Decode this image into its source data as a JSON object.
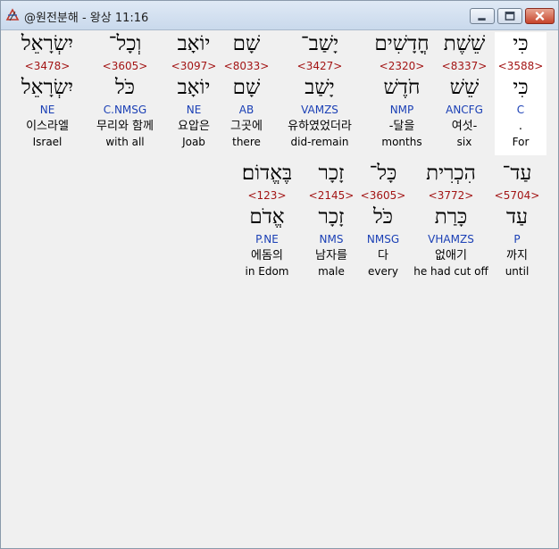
{
  "window": {
    "title": "@원전분해 - 왕상 11:16"
  },
  "lines": [
    {
      "words": [
        {
          "surface": "כִּי",
          "strong": "<3588>",
          "lemma": "כִּי",
          "morph": "C",
          "korean": ".",
          "english": "For",
          "center": 581
        },
        {
          "surface": "שֵׁשֶׁת",
          "strong": "<8337>",
          "lemma": "שֵׁשׁ",
          "morph": "ANCFG",
          "korean": "여섯-",
          "english": "six",
          "center": 518
        },
        {
          "surface": "חֳדָשִׁים",
          "strong": "<2320>",
          "lemma": "חֹדֶשׁ",
          "morph": "NMP",
          "korean": "-달을",
          "english": "months",
          "center": 448
        },
        {
          "surface": "יָשַׁב־",
          "strong": "<3427>",
          "lemma": "יָשַׁב",
          "morph": "VAMZS",
          "korean": "유하였었더라",
          "english": "did-remain",
          "center": 356
        },
        {
          "surface": "שָׁם",
          "strong": "<8033>",
          "lemma": "שָׁם",
          "morph": "AB",
          "korean": "그곳에",
          "english": "there",
          "center": 274
        },
        {
          "surface": "יוֹאָב",
          "strong": "<3097>",
          "lemma": "יוֹאָב",
          "morph": "NE",
          "korean": "요압은",
          "english": "Joab",
          "center": 215
        },
        {
          "surface": "וְכָל־",
          "strong": "<3605>",
          "lemma": "כֹּל",
          "morph": "C.NMSG",
          "korean": "무리와 함께",
          "english": "with all",
          "center": 138
        },
        {
          "surface": "יִשְׂרָאֵל",
          "strong": "<3478>",
          "lemma": "יִשְׂרָאֵל",
          "morph": "NE",
          "korean": "이스라엘",
          "english": "Israel",
          "center": 51
        }
      ]
    },
    {
      "words": [
        {
          "surface": "עַד־",
          "strong": "<5704>",
          "lemma": "עַד",
          "morph": "P",
          "korean": "까지",
          "english": "until",
          "center": 577
        },
        {
          "surface": "הִכְרִית",
          "strong": "<3772>",
          "lemma": "כָּרַת",
          "morph": "VHAMZS",
          "korean": "없애기",
          "english": "he had cut off",
          "center": 503
        },
        {
          "surface": "כָּל־",
          "strong": "<3605>",
          "lemma": "כֹּל",
          "morph": "NMSG",
          "korean": "다",
          "english": "every",
          "center": 427
        },
        {
          "surface": "זָכָר",
          "strong": "<2145>",
          "lemma": "זָכָר",
          "morph": "NMS",
          "korean": "남자를",
          "english": "male",
          "center": 369
        },
        {
          "surface": "בֶּאֱדוֹם׃",
          "strong": "<123>",
          "lemma": "אֱדֹם",
          "morph": "P.NE",
          "korean": "에돔의",
          "english": "in Edom",
          "center": 297
        }
      ]
    }
  ]
}
